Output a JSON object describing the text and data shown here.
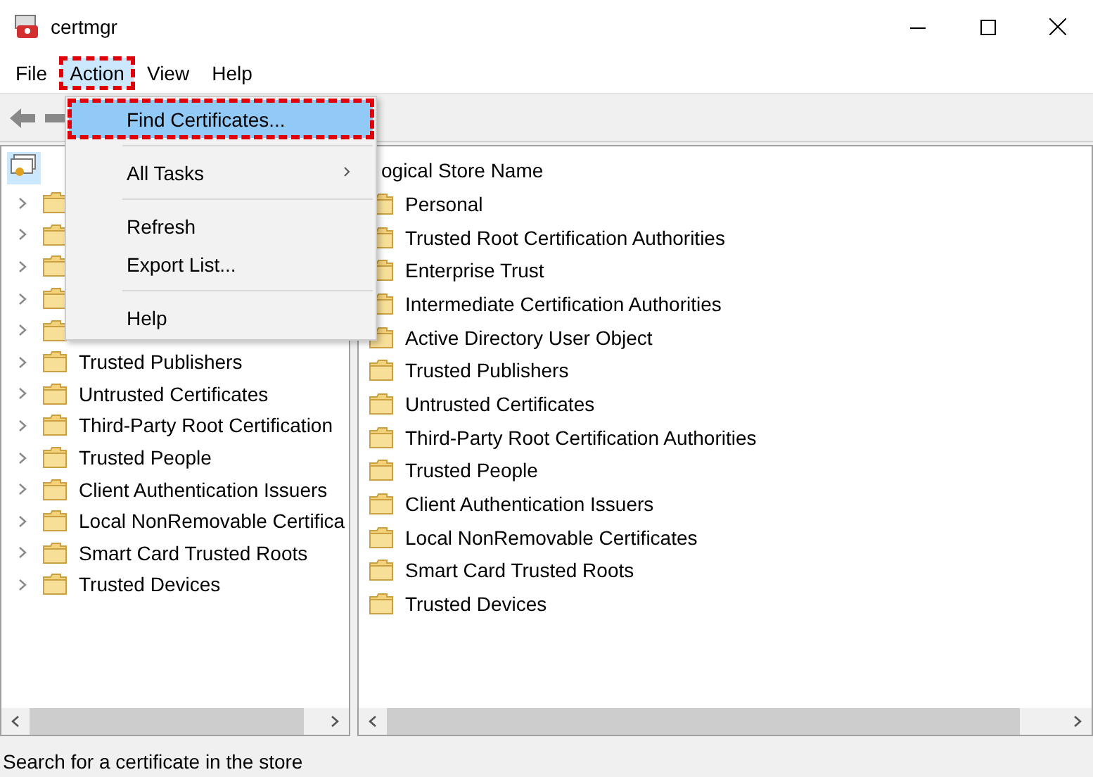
{
  "window": {
    "title": "certmgr"
  },
  "menu_bar": [
    {
      "label": "File",
      "selected": false,
      "highlighted": false
    },
    {
      "label": "Action",
      "selected": true,
      "highlighted": true
    },
    {
      "label": "View",
      "selected": false,
      "highlighted": false
    },
    {
      "label": "Help",
      "selected": false,
      "highlighted": false
    }
  ],
  "tree": {
    "root": {
      "selected": true
    },
    "items": [
      {
        "kind": "hidden"
      },
      {
        "kind": "hidden"
      },
      {
        "kind": "hidden"
      },
      {
        "kind": "hidden"
      },
      {
        "kind": "hidden"
      },
      {
        "kind": "folder",
        "label": "Trusted Publishers"
      },
      {
        "kind": "folder",
        "label": "Untrusted Certificates"
      },
      {
        "kind": "folder",
        "label": "Third-Party Root Certification"
      },
      {
        "kind": "folder",
        "label": "Trusted People"
      },
      {
        "kind": "folder",
        "label": "Client Authentication Issuers"
      },
      {
        "kind": "folder",
        "label": "Local NonRemovable Certifica"
      },
      {
        "kind": "folder",
        "label": "Smart Card Trusted Roots"
      },
      {
        "kind": "folder",
        "label": "Trusted Devices"
      }
    ]
  },
  "list": {
    "header": "ogical Store Name",
    "rows": [
      "Personal",
      "Trusted Root Certification Authorities",
      "Enterprise Trust",
      "Intermediate Certification Authorities",
      "Active Directory User Object",
      "Trusted Publishers",
      "Untrusted Certificates",
      "Third-Party Root Certification Authorities",
      "Trusted People",
      "Client Authentication Issuers",
      "Local NonRemovable Certificates",
      "Smart Card Trusted Roots",
      "Trusted Devices"
    ]
  },
  "action_menu": [
    {
      "kind": "item",
      "label": "Find Certificates...",
      "selected": true,
      "highlighted": true
    },
    {
      "kind": "separator"
    },
    {
      "kind": "submenu",
      "label": "All Tasks",
      "selected": false,
      "highlighted": false
    },
    {
      "kind": "separator"
    },
    {
      "kind": "item",
      "label": "Refresh",
      "selected": false,
      "highlighted": false
    },
    {
      "kind": "item",
      "label": "Export List...",
      "selected": false,
      "highlighted": false
    },
    {
      "kind": "separator"
    },
    {
      "kind": "item",
      "label": "Help",
      "selected": false,
      "highlighted": false
    }
  ],
  "status_bar": {
    "text": "Search for a certificate in the store"
  }
}
